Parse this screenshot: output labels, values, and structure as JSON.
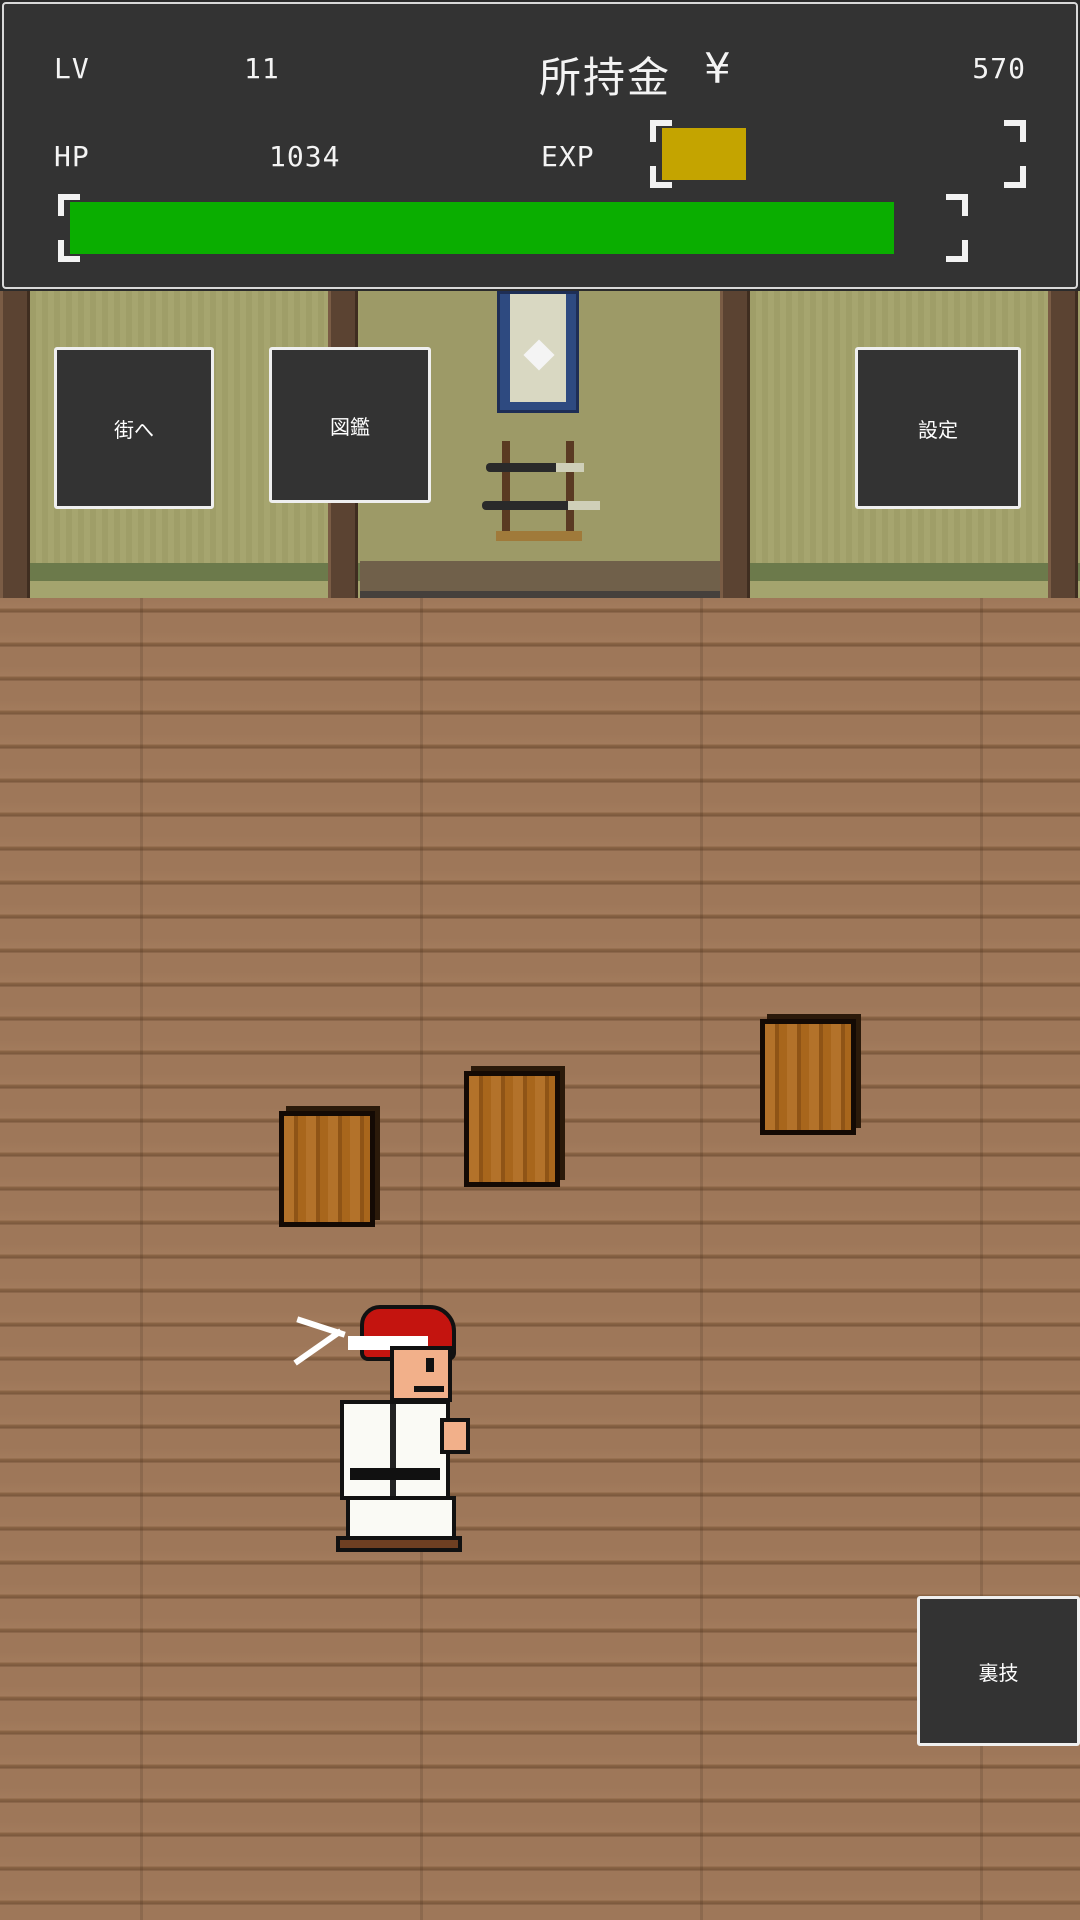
{
  "hud": {
    "lv_label": "LV",
    "lv_value": "11",
    "gold_label": "所持金",
    "gold_symbol": "¥",
    "gold_value": "570",
    "hp_label": "HP",
    "hp_value": "1034",
    "exp_label": "EXP",
    "exp_fraction": 0.24,
    "hp_fraction": 0.93,
    "colors": {
      "exp_bar": "#c4a400",
      "hp_bar": "#0aae00"
    }
  },
  "buttons": {
    "town": "街へ",
    "encyclopedia": "図鑑",
    "settings": "設定",
    "secret_technique": "裏技"
  }
}
